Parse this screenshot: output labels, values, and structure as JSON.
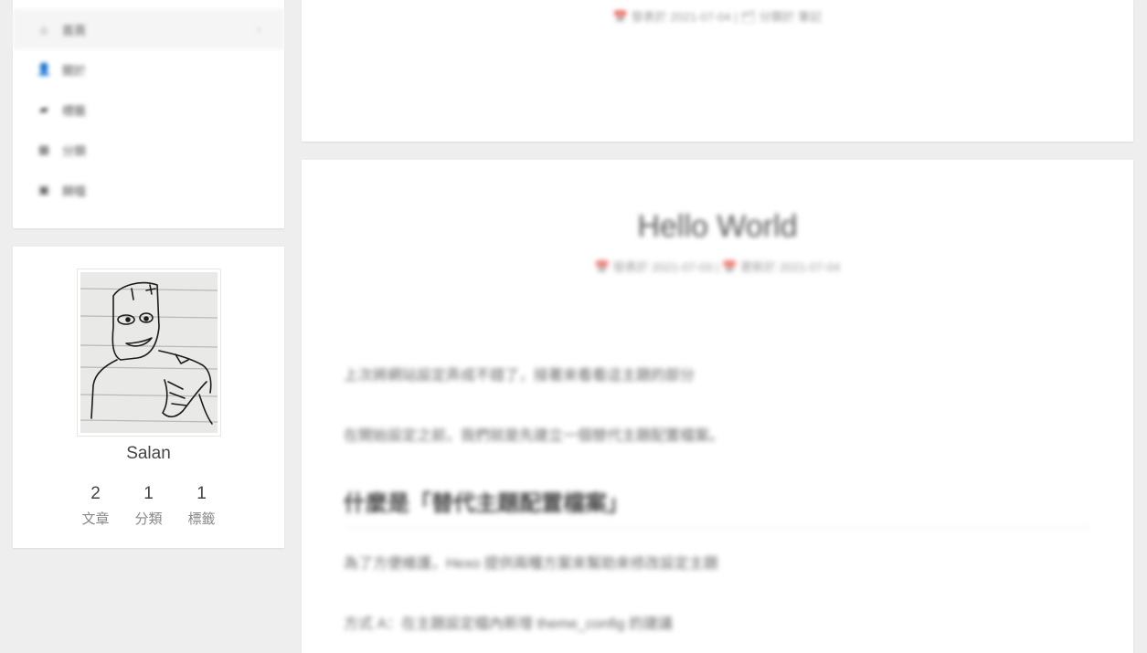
{
  "sidebar": {
    "menu": [
      {
        "icon": "home-icon",
        "glyph": "⌂",
        "label": "首頁",
        "active": true,
        "chevron": "›"
      },
      {
        "icon": "user-icon",
        "glyph": "👤",
        "label": "關於",
        "active": false
      },
      {
        "icon": "tags-icon",
        "glyph": "▰",
        "label": "標籤",
        "active": false
      },
      {
        "icon": "category-icon",
        "glyph": "▦",
        "label": "分類",
        "active": false
      },
      {
        "icon": "archive-icon",
        "glyph": "▣",
        "label": "歸檔",
        "active": false
      }
    ]
  },
  "author": {
    "name": "Salan",
    "stats": [
      {
        "count": "2",
        "label": "文章"
      },
      {
        "count": "1",
        "label": "分類"
      },
      {
        "count": "1",
        "label": "標籤"
      }
    ]
  },
  "posts": {
    "previous_meta": "📅 發表於 2021-07-04 | 🗂 分類於 筆記",
    "current": {
      "title": "Hello World",
      "meta": "📅 發表於 2021-07-03 | 📅 更新於 2021-07-04",
      "paragraphs": [
        "上次將網站設定弄成不錯了，接著來看看這主題的部分",
        "在開始設定之前，我們就是先建立一個替代主題配置檔案。"
      ],
      "heading": "什麼是「替代主題配置檔案」",
      "paragraphs2": [
        "為了方便維護，Hexo 提供兩種方案來幫助來修改設定主題",
        "方式 A：在主題設定檔內新增 theme_config 的建議"
      ]
    }
  }
}
